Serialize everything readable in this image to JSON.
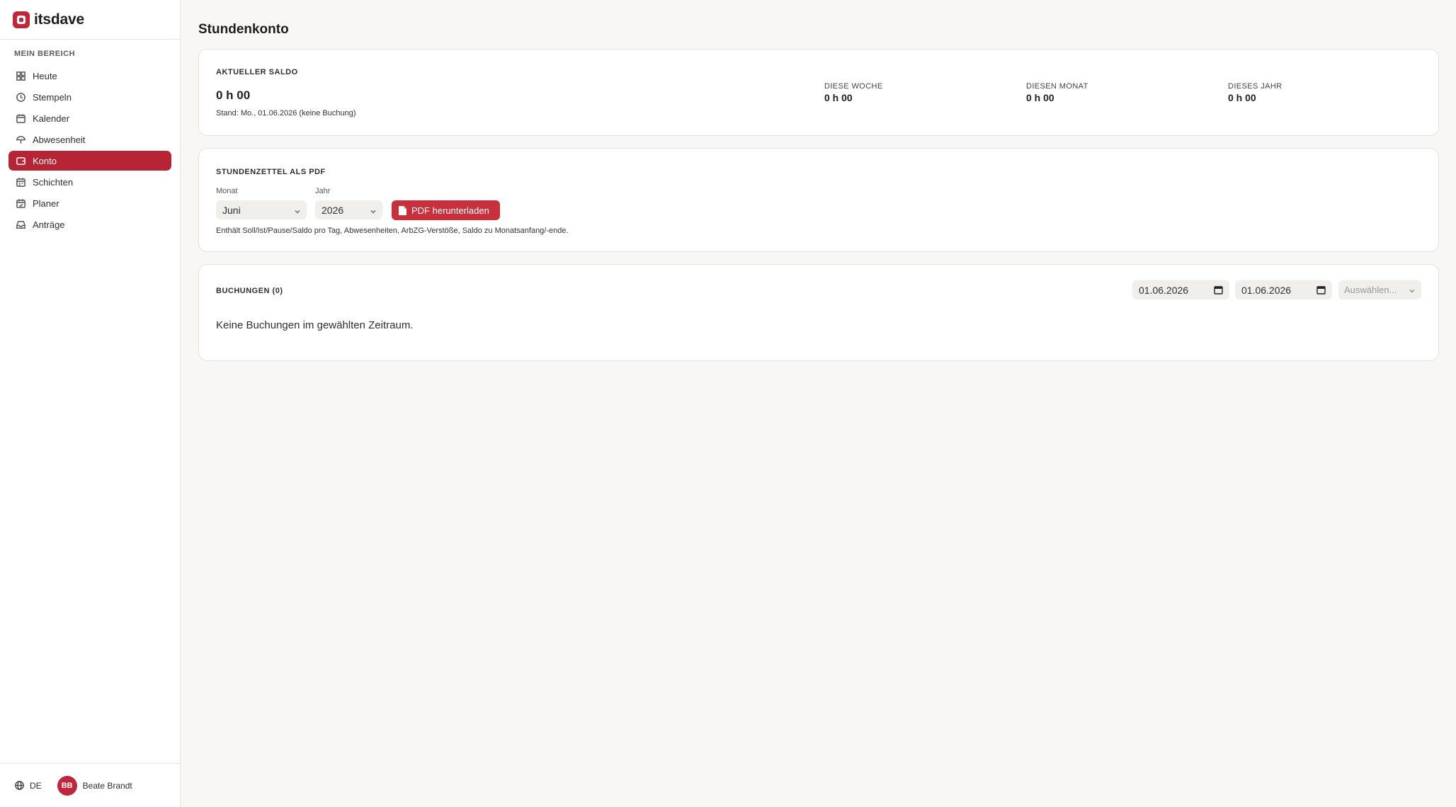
{
  "brand": {
    "name": "itsdave"
  },
  "sidebar": {
    "section_label": "MEIN BEREICH",
    "items": [
      {
        "label": "Heute",
        "icon": "dashboard-icon"
      },
      {
        "label": "Stempeln",
        "icon": "clock-icon"
      },
      {
        "label": "Kalender",
        "icon": "calendar-icon"
      },
      {
        "label": "Abwesenheit",
        "icon": "umbrella-icon"
      },
      {
        "label": "Konto",
        "icon": "wallet-icon",
        "active": true
      },
      {
        "label": "Schichten",
        "icon": "calendar-grid-icon"
      },
      {
        "label": "Planer",
        "icon": "calendar-plan-icon"
      },
      {
        "label": "Anträge",
        "icon": "inbox-icon"
      }
    ],
    "footer": {
      "language": "DE",
      "user_initials": "BB",
      "user_name": "Beate Brandt"
    }
  },
  "page": {
    "title": "Stundenkonto"
  },
  "saldo": {
    "title": "AKTUELLER SALDO",
    "value": "0 h 00",
    "stand": "Stand: Mo., 01.06.2026 (keine Buchung)",
    "stats": [
      {
        "label": "DIESE WOCHE",
        "value": "0 h 00"
      },
      {
        "label": "DIESEN MONAT",
        "value": "0 h 00"
      },
      {
        "label": "DIESES JAHR",
        "value": "0 h 00"
      }
    ]
  },
  "pdf": {
    "title": "STUNDENZETTEL ALS PDF",
    "month_label": "Monat",
    "month_value": "Juni",
    "year_label": "Jahr",
    "year_value": "2026",
    "button_label": "PDF herunterladen",
    "hint": "Enthält Soll/Ist/Pause/Saldo pro Tag, Abwesenheiten, ArbZG-Verstöße, Saldo zu Monatsanfang/-ende."
  },
  "buchungen": {
    "title": "BUCHUNGEN (0)",
    "date_from": "01.06.2026",
    "date_to": "01.06.2026",
    "filter_placeholder": "Auswählen...",
    "empty_message": "Keine Buchungen im gewählten Zeitraum."
  },
  "colors": {
    "accent": "#b72436",
    "button": "#c8303c",
    "background": "#f8f7f5"
  }
}
